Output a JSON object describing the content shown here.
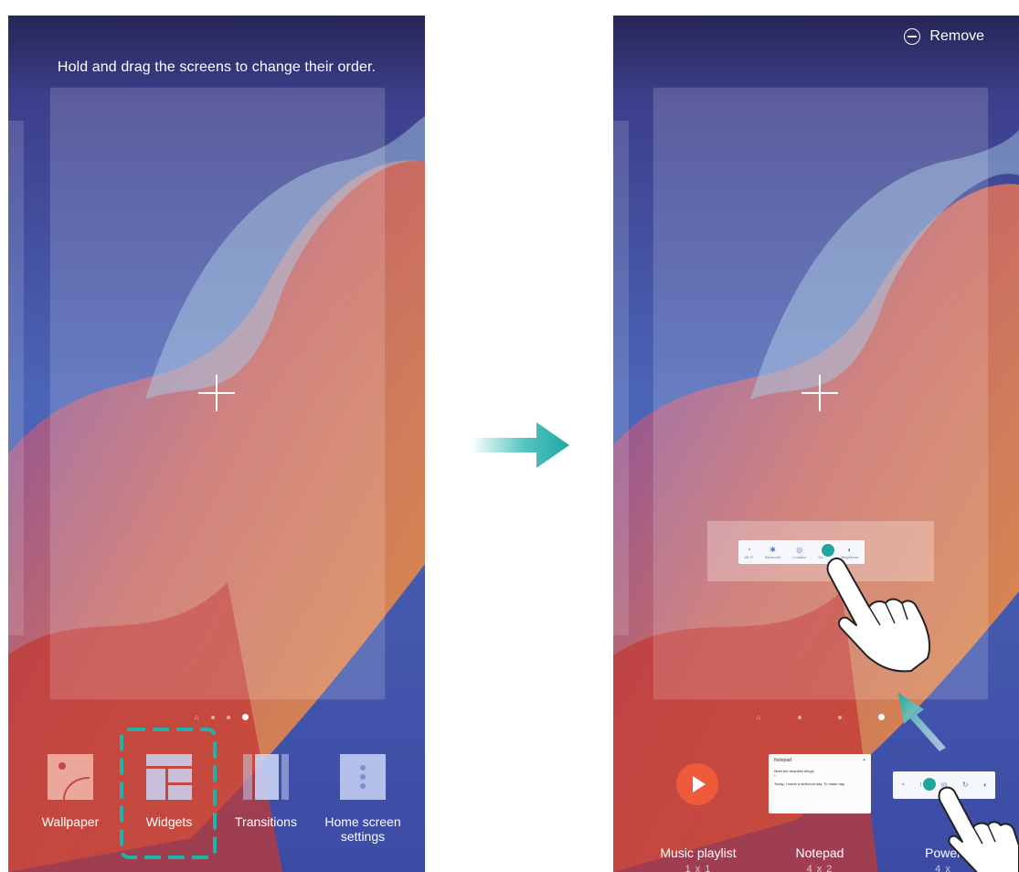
{
  "left_phone": {
    "hint": "Hold and drag the screens to change their order.",
    "toolbar": [
      {
        "label": "Wallpaper",
        "icon": "wallpaper-icon"
      },
      {
        "label": "Widgets",
        "icon": "widgets-icon"
      },
      {
        "label": "Transitions",
        "icon": "transitions-icon"
      },
      {
        "label": "Home screen settings",
        "icon": "home-screen-settings-icon"
      }
    ]
  },
  "right_phone": {
    "remove_label": "Remove",
    "widgets": [
      {
        "name": "Music playlist",
        "size": "1 x 1"
      },
      {
        "name": "Notepad",
        "size": "4 x 2"
      },
      {
        "name": "Power",
        "size": "4 x"
      }
    ],
    "notepad_preview": {
      "title": "Notepad",
      "lines": [
        "Meet the beautiful things",
        "Today, I made a delicious day. To make day"
      ]
    },
    "quick_switches": [
      "Wi-Fi",
      "Bluetooth",
      "Location",
      "Do not",
      "Brightness"
    ]
  },
  "colors": {
    "accent_teal": "#1ea79e",
    "music_red": "#ef5a3a"
  }
}
